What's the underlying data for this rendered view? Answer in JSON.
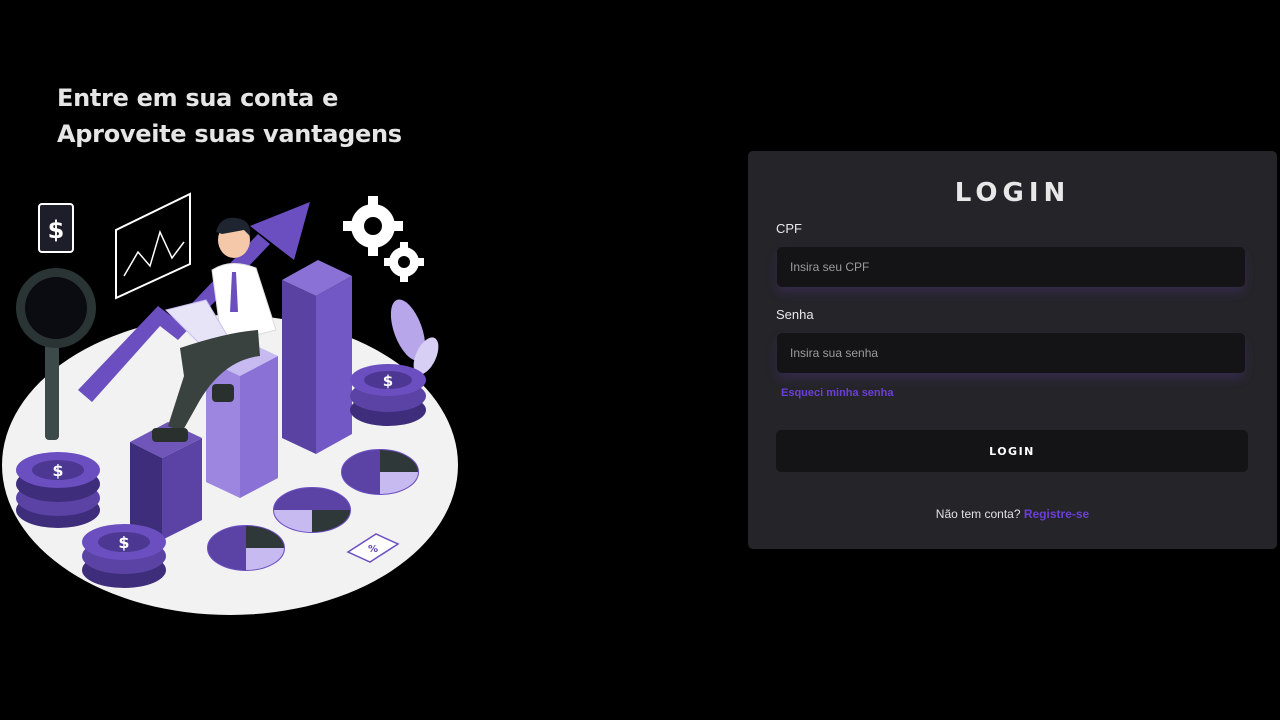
{
  "hero": {
    "line1": "Entre em sua conta e",
    "line2": "Aproveite suas vantagens"
  },
  "login_card": {
    "title": "LOGIN",
    "cpf_label": "CPF",
    "cpf_placeholder": "Insira seu CPF",
    "password_label": "Senha",
    "password_placeholder": "Insira sua senha",
    "forgot_password": "Esqueci minha senha",
    "login_button": "LOGIN",
    "no_account_text": "Não tem conta?",
    "register_link": "Registre-se"
  },
  "colors": {
    "background": "#000000",
    "card": "#252429",
    "input": "#141416",
    "accent": "#6b3fd6",
    "illustration_purple": "#7b5cc9"
  },
  "icons": {
    "illustration": "finance-growth-illustration"
  }
}
